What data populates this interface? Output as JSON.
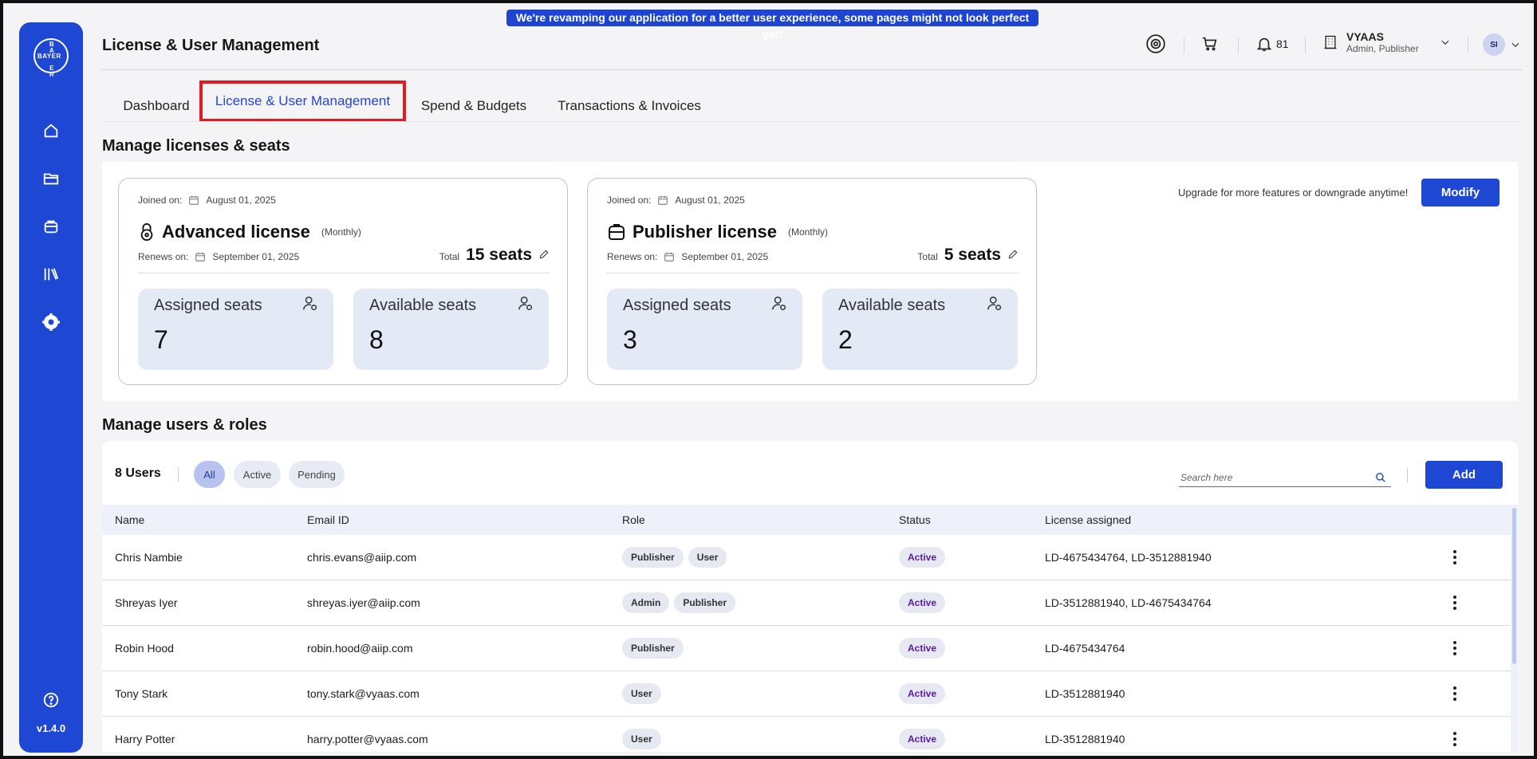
{
  "banner": "We're revamping our application for a better user experience, some pages might not look perfect yet!",
  "sidebar": {
    "logo_text": "BAYER",
    "items": [
      {
        "icon": "home-icon"
      },
      {
        "icon": "folder-icon"
      },
      {
        "icon": "bag-icon"
      },
      {
        "icon": "library-icon"
      },
      {
        "icon": "gear-icon"
      }
    ],
    "help_icon": "help-icon",
    "version": "v1.4.0"
  },
  "header": {
    "title": "License & User Management",
    "notifications_count": "81",
    "user_name": "VYAAS",
    "user_role": "Admin, Publisher",
    "avatar_initials": "SI"
  },
  "tabs": [
    {
      "label": "Dashboard"
    },
    {
      "label": "License & User Management",
      "active": true
    },
    {
      "label": "Spend & Budgets"
    },
    {
      "label": "Transactions & Invoices"
    }
  ],
  "licenses_section": {
    "title": "Manage licenses & seats",
    "upgrade_text": "Upgrade for more features or downgrade anytime!",
    "modify_label": "Modify",
    "cards": [
      {
        "joined_label": "Joined on:",
        "joined_date": "August 01, 2025",
        "name": "Advanced license",
        "period": "(Monthly)",
        "renews_label": "Renews on:",
        "renews_date": "September 01, 2025",
        "total_label": "Total",
        "total_seats": "15 seats",
        "assigned_label": "Assigned seats",
        "assigned": "7",
        "available_label": "Available seats",
        "available": "8"
      },
      {
        "joined_label": "Joined on:",
        "joined_date": "August 01, 2025",
        "name": "Publisher license",
        "period": "(Monthly)",
        "renews_label": "Renews on:",
        "renews_date": "September 01, 2025",
        "total_label": "Total",
        "total_seats": "5 seats",
        "assigned_label": "Assigned seats",
        "assigned": "3",
        "available_label": "Available seats",
        "available": "2"
      }
    ]
  },
  "users_section": {
    "title": "Manage users & roles",
    "count": "8 Users",
    "filters": [
      "All",
      "Active",
      "Pending"
    ],
    "search_placeholder": "Search here",
    "add_label": "Add",
    "columns": [
      "Name",
      "Email ID",
      "Role",
      "Status",
      "License assigned"
    ],
    "rows": [
      {
        "name": "Chris Nambie",
        "email": "chris.evans@aiip.com",
        "roles": [
          "Publisher",
          "User"
        ],
        "status": "Active",
        "license": "LD-4675434764, LD-3512881940"
      },
      {
        "name": "Shreyas Iyer",
        "email": "shreyas.iyer@aiip.com",
        "roles": [
          "Admin",
          "Publisher"
        ],
        "status": "Active",
        "license": "LD-3512881940, LD-4675434764"
      },
      {
        "name": "Robin Hood",
        "email": "robin.hood@aiip.com",
        "roles": [
          "Publisher"
        ],
        "status": "Active",
        "license": "LD-4675434764"
      },
      {
        "name": "Tony Stark",
        "email": "tony.stark@vyaas.com",
        "roles": [
          "User"
        ],
        "status": "Active",
        "license": "LD-3512881940"
      },
      {
        "name": "Harry Potter",
        "email": "harry.potter@vyaas.com",
        "roles": [
          "User"
        ],
        "status": "Active",
        "license": "LD-3512881940"
      }
    ]
  },
  "colors": {
    "brand": "#1e47d3",
    "active_tab_highlight": "#e21a22",
    "status_text": "#5a1aa0"
  }
}
